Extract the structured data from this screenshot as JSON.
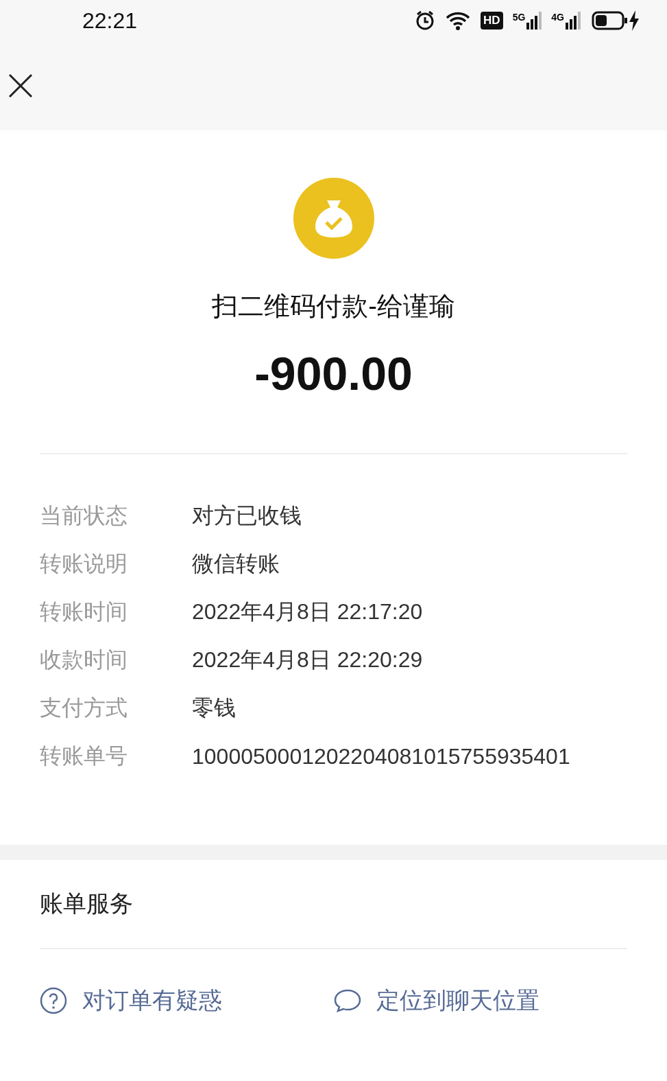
{
  "status_bar": {
    "time": "22:21",
    "hd": "HD",
    "networks": [
      {
        "label": "5G"
      },
      {
        "label": "4G"
      }
    ],
    "charging": true
  },
  "header": {
    "title": "扫二维码付款-给谨瑜",
    "amount": "-900.00"
  },
  "details": [
    {
      "label": "当前状态",
      "value": "对方已收钱"
    },
    {
      "label": "转账说明",
      "value": "微信转账"
    },
    {
      "label": "转账时间",
      "value": "2022年4月8日 22:17:20"
    },
    {
      "label": "收款时间",
      "value": "2022年4月8日 22:20:29"
    },
    {
      "label": "支付方式",
      "value": "零钱"
    },
    {
      "label": "转账单号",
      "value": "1000050001202204081015755935401"
    }
  ],
  "service": {
    "title": "账单服务",
    "actions": [
      {
        "kind": "question",
        "label": "对订单有疑惑"
      },
      {
        "kind": "chat",
        "label": "定位到聊天位置"
      }
    ]
  }
}
